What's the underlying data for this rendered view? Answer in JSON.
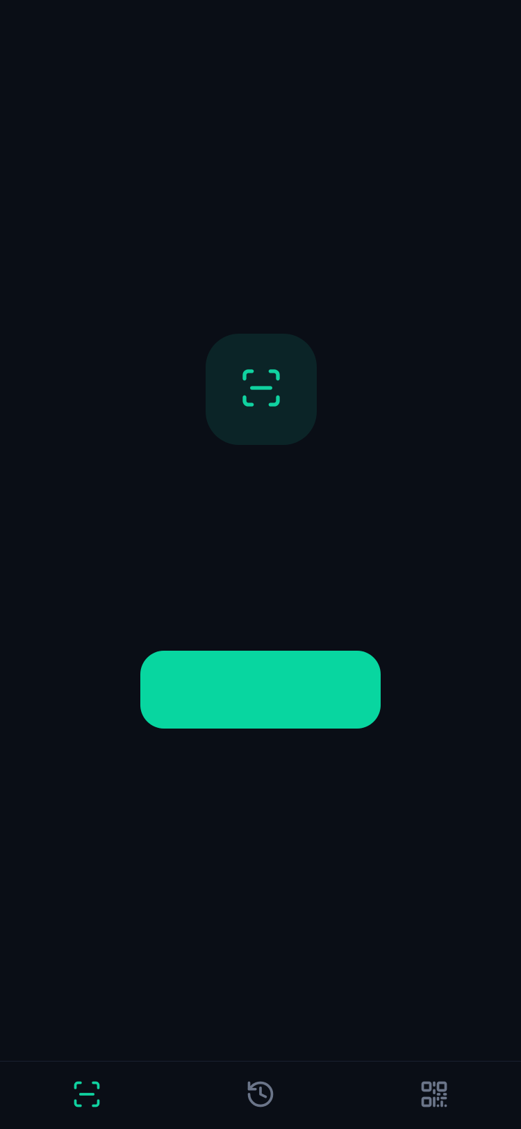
{
  "theme": {
    "background": "#0a0e16",
    "tile_background": "#0b2427",
    "accent": "#08d6a0",
    "inactive_icon": "#6b7589"
  },
  "hero": {
    "icon": "scan-icon"
  },
  "primary_button": {
    "label": ""
  },
  "bottom_nav": {
    "items": [
      {
        "icon": "scan-icon",
        "active": true
      },
      {
        "icon": "history-icon",
        "active": false
      },
      {
        "icon": "qr-code-icon",
        "active": false
      }
    ]
  }
}
